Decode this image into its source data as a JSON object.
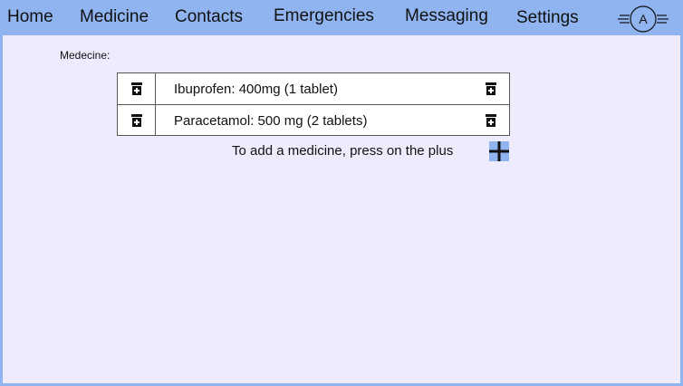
{
  "nav": {
    "items": [
      {
        "label": "Home"
      },
      {
        "label": "Medicine"
      },
      {
        "label": "Contacts"
      },
      {
        "label": "Emergencies"
      },
      {
        "label": "Messaging"
      },
      {
        "label": "Settings"
      }
    ],
    "profile_initial": "A",
    "profile_icon": "avatar-icon"
  },
  "page": {
    "section_label": "Medecine:"
  },
  "medicines": [
    {
      "label": "Ibuprofen: 400mg (1 tablet)",
      "icon": "medicine-bottle-icon"
    },
    {
      "label": "Paracetamol: 500 mg (2 tablets)",
      "icon": "medicine-bottle-icon"
    }
  ],
  "add": {
    "hint": "To add a medicine, press on the plus",
    "icon": "plus-icon"
  },
  "colors": {
    "header": "#8fb4ef",
    "background": "#eeecfc",
    "plus_fill": "#8fb4ef"
  }
}
